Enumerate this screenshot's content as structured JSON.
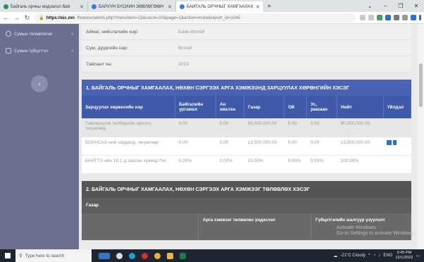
{
  "browser": {
    "tabs": [
      {
        "title": "Байгаль орчны мэдээлэл бай",
        "active": false,
        "color": "#2f8f4e"
      },
      {
        "title": "БАРУУН БҮСИЙН ЗӨВЛӨГӨӨН",
        "active": false,
        "color": "#3b7dd8"
      },
      {
        "title": "БАЙГАЛЬ ОРЧНЫГ ХАМГААЛАХ",
        "active": true,
        "color": "#3b7dd8"
      }
    ],
    "url_host": "https://eic.mn",
    "url_path": "/finance/admin.php?menuitem=13&count=10&page=1&action=more&report_id=1045"
  },
  "sidebar": {
    "items": [
      {
        "label": "Сумын төлөвлөгөө"
      },
      {
        "label": "Сумын гүйцэтгэл"
      }
    ],
    "accent": "#6b6f91"
  },
  "info": {
    "rows": [
      {
        "key": "Аймаг, нийслэлийн нэр:",
        "value": "Баян-Өлгий"
      },
      {
        "key": "Сум, дүүргийн нэр:",
        "value": "Өлгий"
      },
      {
        "key": "Тайлант он:",
        "value": "2023"
      }
    ]
  },
  "section1": {
    "title": "1. БАЙГАЛЬ ОРЧНЫГ ХАМГААЛАХ, НӨХӨН СЭРГЭЭХ АРГА ХЭМЖЭЭНД ЗАРЦУУЛАХ ХӨРӨНГИЙН ХЭСЭГ",
    "columns": [
      "Зарцуулах хөрөнгийн нэр",
      "Байгалийн ургамал",
      "Ан амьтан",
      "Газар",
      "Ой",
      "Ус, рашаан",
      "Нийт",
      "Үйлдэл"
    ],
    "rows": [
      [
        "Төвлөрүүлж төлбөрийн орлого, төгрөгөөр",
        "0.00",
        "0.00",
        "90,000,000.00",
        "0.00",
        "0.00",
        "90,000,000.00",
        ""
      ],
      [
        "БОХНСАХ-ний зардалд, төгрөгөөр",
        "0.00",
        "0.00",
        "13,500,000.00",
        "0.00",
        "0.00",
        "13,500,000.00",
        ""
      ],
      [
        "БНАТТХ-ийн 18.1-д заасан хувиар /%/",
        "0.00%",
        "0.00%",
        "15.00%",
        "0.00%",
        "0.00%",
        "100.00%",
        ""
      ]
    ],
    "header_color": "#4a63b7"
  },
  "section2": {
    "title": "2. БАЙГАЛЬ ОРЧНЫГ ХАМГААЛАХ, НӨХӨН СЭРГЭЭХ АРГА ХЭМЖЭЭГ ТӨЛӨВЛӨХ ХЭСЭГ",
    "subtitle": "Газар",
    "col_a": "Арга хэмжээг төлөвлөх үндэслэл",
    "col_b": "Гүйцэтгэлийн шалгуур үзүүлэлт"
  },
  "watermark": {
    "line1": "Activate Windows",
    "line2": "Go to Settings to activate Windows."
  },
  "taskbar": {
    "search_placeholder": "Type here to search",
    "weather": "-21°C Cloudy",
    "lang": "ENG",
    "time": "3:45 PM",
    "date": "12/1/2022"
  }
}
